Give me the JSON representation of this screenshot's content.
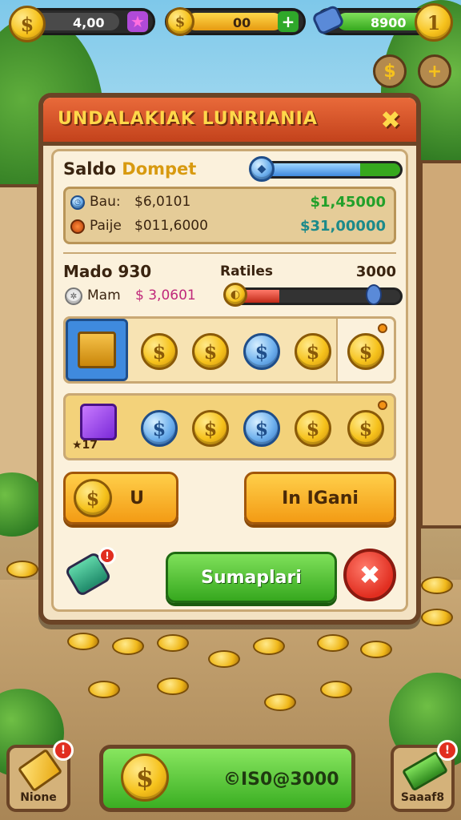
{
  "top_bar": {
    "coins_value": "4,00",
    "gold_value": "00",
    "gems_value": "8900",
    "level_value": "1",
    "dollar_symbol": "$",
    "plus_symbol": "+"
  },
  "side_buttons": {
    "shop_symbol": "$",
    "add_symbol": "+"
  },
  "panel": {
    "title": "UNDALAKIAK LUNRIANIA",
    "close_symbol": "✖",
    "wallet": {
      "label_part1": "Saldo",
      "label_part2": "Dompet",
      "progress": 0.72,
      "line1_label": "Bau:",
      "line1_value": "$6,0101",
      "line1_right": "$1,45000",
      "line2_label": "Paije",
      "line2_value": "$011,6000",
      "line2_right": "$31,00000"
    },
    "mode": {
      "label": "Mado 930",
      "sub_label": "Mam",
      "sub_value": "$ 3,0601",
      "rates_label": "Ratiles",
      "rates_value": "3000",
      "progress": 0.28
    },
    "slots_row1": {
      "coins": [
        "$",
        "$",
        "$",
        "$",
        "$"
      ]
    },
    "slots_row2": {
      "badge_text": "★17",
      "coins": [
        "$",
        "$",
        "$",
        "$",
        "$"
      ]
    },
    "buttons": {
      "left_label": "U",
      "right_label": "In IGani",
      "confirm_label": "Sumaplari",
      "cancel_symbol": "✖"
    }
  },
  "bottom_bar": {
    "left_label": "Nione",
    "balance_value": "©IS0@3000",
    "right_label": "Saaaf8",
    "left_badge": "!",
    "right_badge": "!"
  },
  "colors": {
    "panel_border": "#6b4426",
    "title_bg": "#c3421c",
    "title_text": "#ffd84a",
    "confirm_green": "#36a81e",
    "button_orange": "#f39b14"
  }
}
